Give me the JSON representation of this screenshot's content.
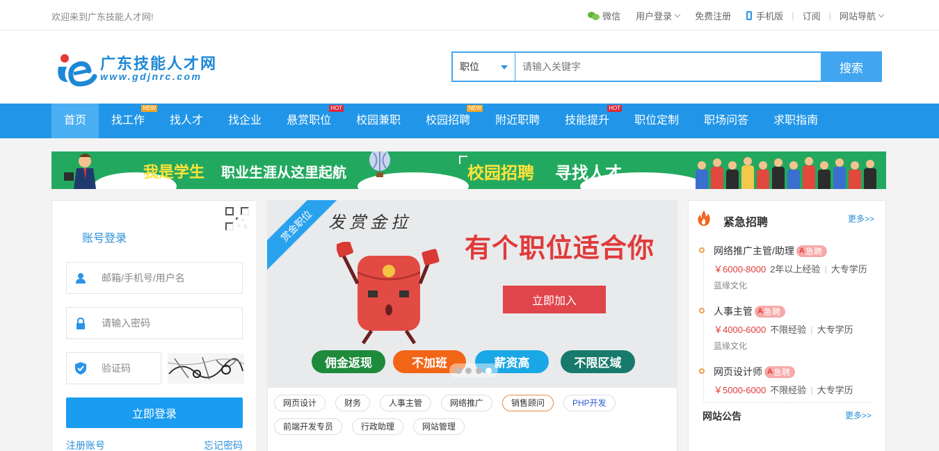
{
  "topbar": {
    "welcome": "欢迎来到广东技能人才网!",
    "wechat": "微信",
    "user_login": "用户登录",
    "register": "免费注册",
    "mobile": "手机版",
    "subscribe": "订阅",
    "site_nav": "网站导航"
  },
  "logo": {
    "name": "广东技能人才网",
    "domain": "www.gdjnrc.com"
  },
  "search": {
    "category": "职位",
    "placeholder": "请输入关键字",
    "button": "搜索"
  },
  "nav": {
    "items": [
      {
        "label": "首页",
        "tag": ""
      },
      {
        "label": "找工作",
        "tag": "NEW"
      },
      {
        "label": "找人才",
        "tag": ""
      },
      {
        "label": "找企业",
        "tag": ""
      },
      {
        "label": "悬赏职位",
        "tag": "HOT"
      },
      {
        "label": "校园兼职",
        "tag": ""
      },
      {
        "label": "校园招聘",
        "tag": "NEW"
      },
      {
        "label": "附近职聘",
        "tag": ""
      },
      {
        "label": "技能提升",
        "tag": "HOT"
      },
      {
        "label": "职位定制",
        "tag": ""
      },
      {
        "label": "职场问答",
        "tag": ""
      },
      {
        "label": "求职指南",
        "tag": ""
      }
    ]
  },
  "banner": {
    "text1": "我是学生",
    "text2": "职业生涯从这里起航",
    "text3": "校园招聘",
    "text4": "寻找人才"
  },
  "login": {
    "title": "账号登录",
    "username_placeholder": "邮箱/手机号/用户名",
    "password_placeholder": "请输入密码",
    "captcha_placeholder": "验证码",
    "submit": "立即登录",
    "register": "注册账号",
    "forgot": "忘记密码"
  },
  "promo": {
    "ribbon": "赏金职位",
    "handwriting": "发赏金拉",
    "headline": "有个职位适合你",
    "join": "立即加入",
    "pills": [
      "佣金返现",
      "不加班",
      "薪资高",
      "不限区域"
    ],
    "active_slide": 4
  },
  "tags": {
    "row1": [
      "网页设计",
      "财务",
      "人事主管",
      "网络推广",
      "销售顾问",
      "PHP开发"
    ],
    "row2": [
      "前端开发专员",
      "行政助理",
      "网站管理"
    ]
  },
  "urgent": {
    "title": "紧急招聘",
    "more": "更多>>",
    "badge": "急聘",
    "jobs": [
      {
        "title": "网络推广主管/助理",
        "salary": "￥6000-8000",
        "exp": "2年以上经验",
        "edu": "大专学历",
        "company": "蓝缘文化"
      },
      {
        "title": "人事主管",
        "salary": "￥4000-6000",
        "exp": "不限经验",
        "edu": "大专学历",
        "company": "蓝缘文化"
      },
      {
        "title": "网页设计师",
        "salary": "￥5000-6000",
        "exp": "不限经验",
        "edu": "大专学历",
        "company": ""
      }
    ],
    "notice_title": "网站公告",
    "notice_more": "更多>>"
  },
  "colors": {
    "primary": "#2196e8",
    "accent_red": "#e03a3a",
    "banner_green": "#23a95f"
  }
}
